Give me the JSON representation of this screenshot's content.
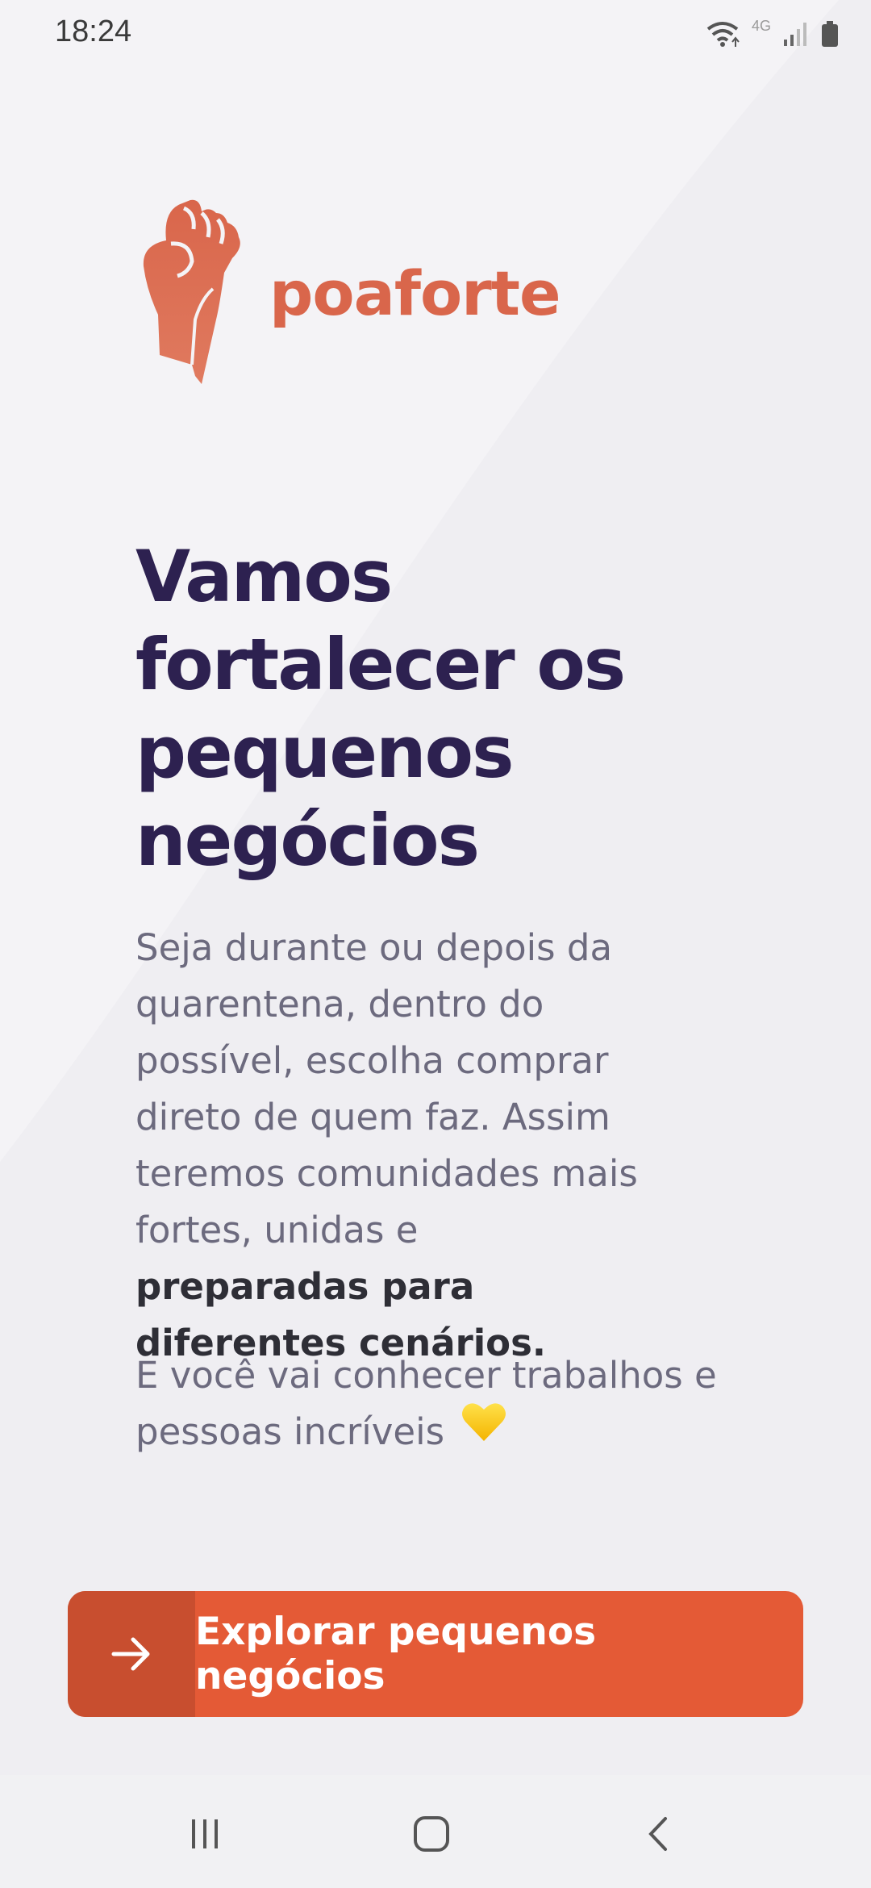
{
  "status_bar": {
    "time": "18:24",
    "network": "4G",
    "icons": [
      "wifi-icon",
      "signal-icon",
      "battery-icon"
    ]
  },
  "logo": {
    "text": "poaforte",
    "icon": "raised-fist-icon",
    "color": "#d9664b"
  },
  "headline": {
    "lines": [
      "Vamos",
      "fortalecer os",
      "pequenos",
      "negócios"
    ],
    "color": "#2d2150"
  },
  "body": {
    "text": "Seja durante ou depois da quarentena, dentro do possível, escolha comprar direto de quem faz. Assim teremos comunidades mais fortes, unidas e",
    "bold": "preparadas para diferentes cenários.",
    "text2": "E você vai conhecer trabalhos e pessoas incríveis",
    "emoji": "yellow-heart-icon"
  },
  "cta": {
    "label": "Explorar pequenos negócios",
    "icon": "arrow-right-icon",
    "color": "#e45a36",
    "icon_bg": "#c84e2f"
  },
  "nav": {
    "items": [
      "recent-apps-icon",
      "home-icon",
      "back-icon"
    ]
  }
}
